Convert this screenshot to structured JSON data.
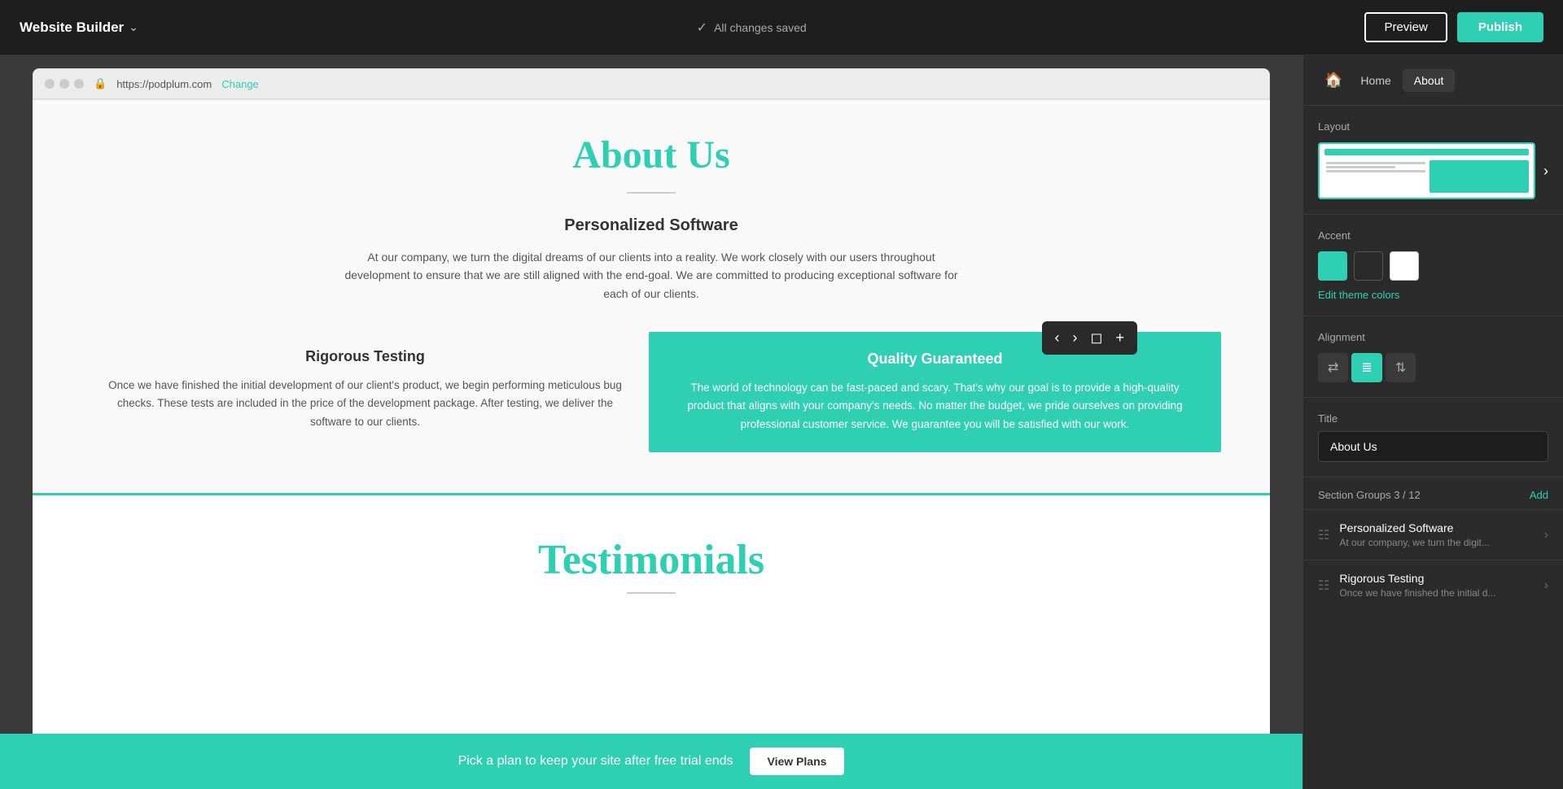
{
  "topbar": {
    "title": "Website Builder",
    "status": "All changes saved",
    "preview_label": "Preview",
    "publish_label": "Publish"
  },
  "browser": {
    "url": "https://podplum.com",
    "change_label": "Change"
  },
  "page": {
    "about_title": "About Us",
    "personalized_title": "Personalized Software",
    "personalized_desc": "At our company, we turn the digital dreams of our clients into a reality. We work closely with our users throughout development to ensure that we are still aligned with the end-goal. We are committed to producing exceptional software for each of our clients.",
    "rigorous_title": "Rigorous Testing",
    "rigorous_desc": "Once we have finished the initial development of our client's product, we begin performing meticulous bug checks. These tests are included in the price of the development package. After testing, we deliver the software to our clients.",
    "quality_title": "Quality Guaranteed",
    "quality_desc": "The world of technology can be fast-paced and scary. That's why our goal is to provide a high-quality product that aligns with your company's needs. No matter the budget, we pride ourselves on providing professional customer service. We guarantee you will be satisfied with our work.",
    "testimonials_title": "Testimonials"
  },
  "bottom_banner": {
    "text": "Pick a plan to keep your site after free trial ends",
    "btn_label": "View Plans"
  },
  "right_panel": {
    "nav": {
      "home_icon": "🏠",
      "items": [
        "Home",
        "About"
      ]
    },
    "layout_label": "Layout",
    "accent_label": "Accent",
    "edit_theme_label": "Edit theme colors",
    "alignment_label": "Alignment",
    "title_label": "Title",
    "title_value": "About Us",
    "section_groups_label": "Section Groups 3 / 12",
    "section_groups_add": "Add",
    "groups": [
      {
        "name": "Personalized Software",
        "desc": "At our company, we turn the digit..."
      },
      {
        "name": "Rigorous Testing",
        "desc": "Once we have finished the initial d..."
      }
    ]
  }
}
